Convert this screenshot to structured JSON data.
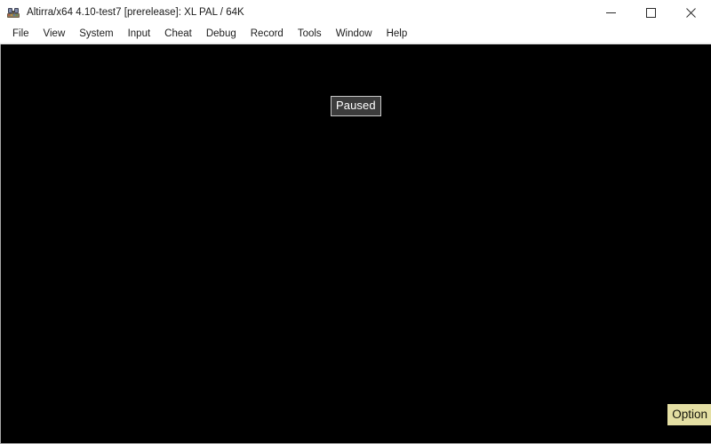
{
  "window": {
    "icon_name": "altirra-app-icon",
    "title": "Altirra/x64 4.10-test7 [prerelease]: XL PAL / 64K",
    "controls": {
      "minimize_label": "Minimize",
      "maximize_label": "Maximize",
      "close_label": "Close"
    }
  },
  "menu": {
    "items": [
      {
        "label": "File"
      },
      {
        "label": "View"
      },
      {
        "label": "System"
      },
      {
        "label": "Input"
      },
      {
        "label": "Cheat"
      },
      {
        "label": "Debug"
      },
      {
        "label": "Record"
      },
      {
        "label": "Tools"
      },
      {
        "label": "Window"
      },
      {
        "label": "Help"
      }
    ]
  },
  "display": {
    "background_color": "#000000",
    "paused_indicator": {
      "label": "Paused",
      "background_color": "#3c3c3c",
      "border_color": "#c8c8c8",
      "text_color": "#ffffff"
    },
    "option_indicator": {
      "label": "Option",
      "background_color": "#e4dfa3",
      "text_color": "#14140a"
    }
  }
}
